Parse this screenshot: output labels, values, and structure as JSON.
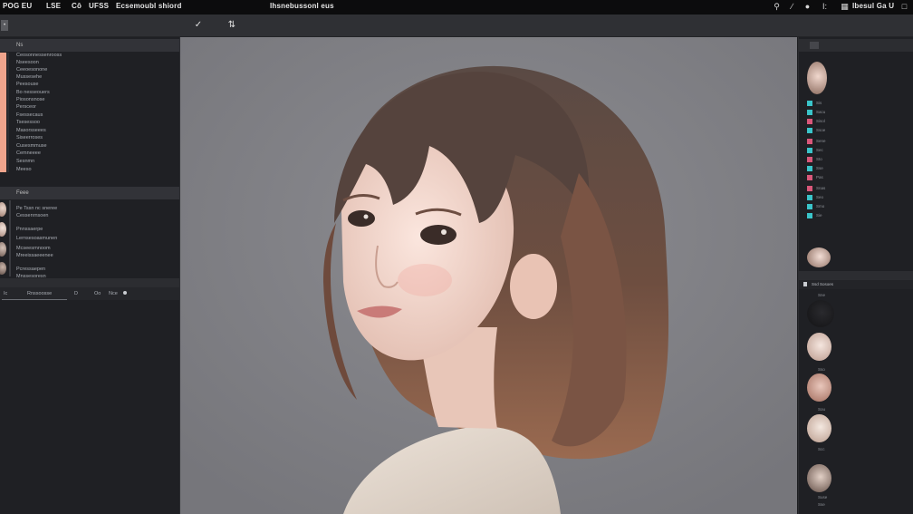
{
  "menubar": {
    "items": [
      "POG EU",
      "LSE",
      "Cô",
      "UFSS",
      "Ecsemoubl shiord",
      "Ihsnebussonl eus"
    ],
    "right_text": "Ibesul Ga U"
  },
  "options_bar": {
    "commit_icon": "check-icon",
    "transform_icon": "move-icon"
  },
  "left_panel": {
    "header_1": "Ns",
    "items_1": [
      "Ceosonnessenrooss",
      "Nseesoon",
      "Ceeoesonone",
      "Mussesehe",
      "Peesouse",
      "Bo nesseouers",
      "Piosonsnose",
      "Persceor",
      "Fsessecaus",
      "Tsesessoo",
      "Masorsseees",
      "Siseerroses",
      "Cusesmmuse",
      "Cemneeee",
      "Sesnmn",
      "Meeso"
    ],
    "header_2": "Feee",
    "items_2": [
      "Pe Tssn nc sneree",
      "Cessenrnsoen",
      "Pnnssaerpe",
      "Lernsesoasmunen",
      "Mcseesrnnoom",
      "Mreeissaeeenee",
      "Pcressaepen",
      "Mnssesoresn"
    ],
    "footer_labels": [
      "Ic",
      "Rnssoosse",
      "D",
      "Oo",
      "Nce"
    ]
  },
  "right_panel": {
    "colors": {
      "teal": "#3ac4c9",
      "pink": "#d9577a",
      "salmon": "#f0a48c"
    },
    "channels": [
      "Sis",
      "Sacu",
      "Sisol",
      "Ssoe",
      "Sene",
      "Sec",
      "Sto",
      "Sse",
      "Pas",
      "Snas",
      "Seo",
      "Smo",
      "Sie"
    ],
    "layers_header": "Ssd Sosoes",
    "layer_labels": [
      "Sne",
      "Sso",
      "Sou",
      "Scc",
      "Suse",
      "Sse"
    ]
  }
}
